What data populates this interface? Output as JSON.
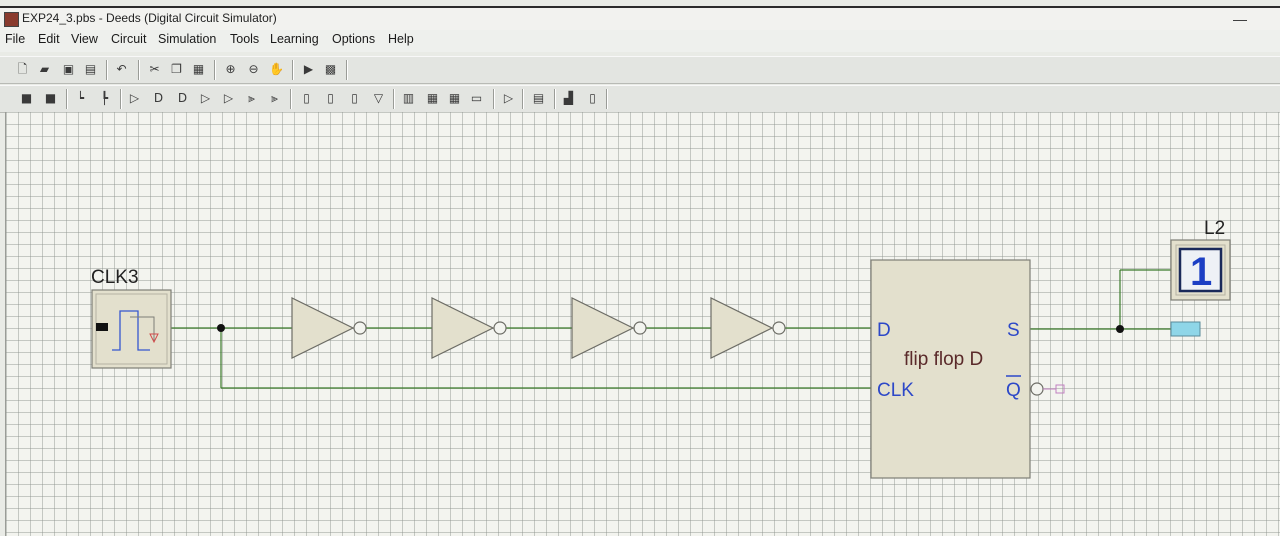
{
  "window": {
    "title": "EXP24_3.pbs - Deeds (Digital Circuit Simulator)",
    "minimize_symbol": "—"
  },
  "menu": [
    "File",
    "Edit",
    "View",
    "Circuit",
    "Simulation",
    "Tools",
    "Learning",
    "Options",
    "Help"
  ],
  "toolbar1_icons": [
    "new-file-icon",
    "open-folder-icon",
    "save-icon",
    "print-icon",
    "undo-icon",
    "cut-icon",
    "copy-icon",
    "paste-icon",
    "zoom-in-icon",
    "zoom-out-icon",
    "pan-hand-icon",
    "run-icon",
    "timing-icon"
  ],
  "toolbar2_icons": [
    "wire-icon",
    "bus-icon",
    "input-pin-icon",
    "output-pin-icon",
    "not-gate-icon",
    "and-gate-icon",
    "or-gate-icon",
    "nand-gate-icon",
    "nor-gate-icon",
    "xor-gate-icon",
    "flip-flop-icon",
    "latch-icon",
    "counter-icon",
    "mux-icon",
    "register-icon",
    "memory-icon",
    "display-icon",
    "lcd-icon",
    "buffer-icon",
    "block-icon",
    "microcomputer-icon",
    "fsm-icon"
  ],
  "circuit": {
    "clock": {
      "label": "CLK3"
    },
    "inverter_count": 4,
    "flipflop": {
      "name": "flip flop D",
      "pin_d": "D",
      "pin_clk": "CLK",
      "pin_s": "S",
      "pin_q": "Q"
    },
    "led": {
      "label": "L2",
      "value": "1"
    }
  },
  "colors": {
    "wire": "#3a7a2a",
    "pin_text": "#2d48c8",
    "component_fill": "#e3e0cd",
    "component_stroke": "#7e7e76",
    "led_output": "#8fd6e8"
  }
}
